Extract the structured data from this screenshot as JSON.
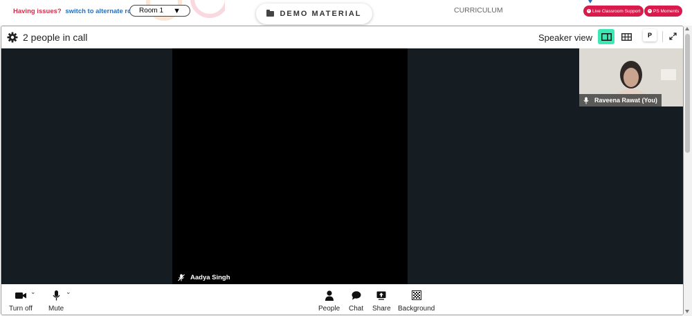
{
  "topbar": {
    "issues_text": "Having issues?",
    "alternate_link": "switch to alternate room",
    "room_value": "Room 1",
    "demo_material": "DEMO MATERIAL",
    "curriculum": "CURRICULUM",
    "live_support": "Live Classroom Support",
    "ps_moments": "PS Moments"
  },
  "call": {
    "people_count": "2 people in call",
    "view_label": "Speaker view",
    "p_button": "P",
    "main_participant": "Aadya Singh",
    "self_participant": "Raveena Rawat (You)"
  },
  "toolbar": {
    "camera_label": "Turn off",
    "mute_label": "Mute",
    "people_label": "People",
    "chat_label": "Chat",
    "share_label": "Share",
    "background_label": "Background"
  },
  "colors": {
    "accent_green": "#3ee8b5",
    "brand_red": "#d81b4c",
    "stage_bg": "#151c22",
    "link_blue": "#2a6fb8"
  }
}
